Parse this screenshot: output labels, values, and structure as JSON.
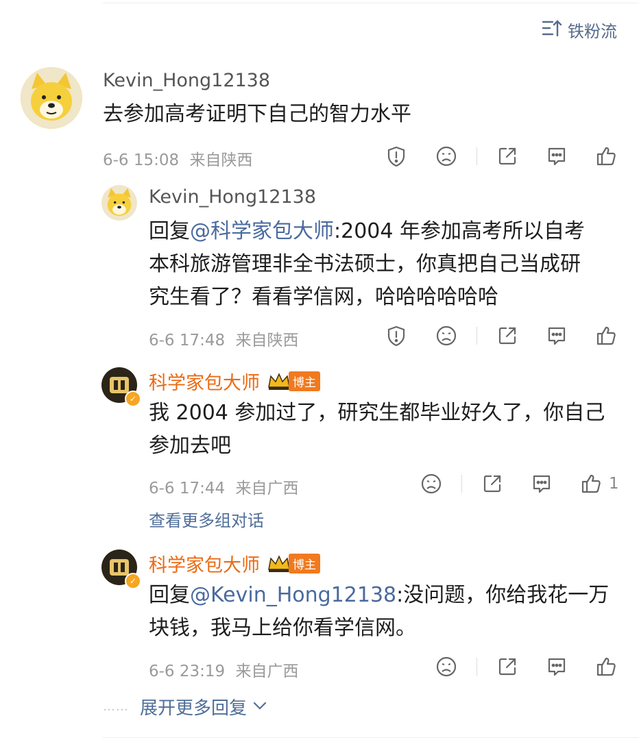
{
  "header": {
    "sort_label": "铁粉流"
  },
  "main_comment": {
    "username": "Kevin_Hong12138",
    "text": "去参加高考证明下自己的智力水平",
    "time": "6-6 15:08",
    "location": "来自陕西"
  },
  "replies": [
    {
      "username": "Kevin_Hong12138",
      "reply_prefix": "回复",
      "mention": "@科学家包大师",
      "text_line1": ":2004 年参加高考所以自考",
      "text_line2": "本科旅游管理非全书法硕士，你真把自己当成研",
      "text_line3": "究生看了？看看学信网，哈哈哈哈哈哈",
      "time": "6-6 17:48",
      "location": "来自陕西"
    },
    {
      "username": "科学家包大师",
      "badge": "博主",
      "text_line1": "我 2004 参加过了，研究生都毕业好久了，你自己",
      "text_line2": "参加去吧",
      "time": "6-6 17:44",
      "location": "来自广西",
      "likes": "1"
    },
    {
      "username": "科学家包大师",
      "badge": "博主",
      "reply_prefix": "回复",
      "mention": "@Kevin_Hong12138",
      "text_line1": ":没问题，你给我花一万",
      "text_line2": "块钱，我马上给你看学信网。",
      "time": "6-6 23:19",
      "location": "来自广西"
    }
  ],
  "links": {
    "view_more_conversation": "查看更多组对话",
    "expand_more": "展开更多回复",
    "dots": "……"
  },
  "colors": {
    "mention": "#4a6a9e",
    "blogger_name": "#ea6a13",
    "badge": "#f07a1f"
  }
}
